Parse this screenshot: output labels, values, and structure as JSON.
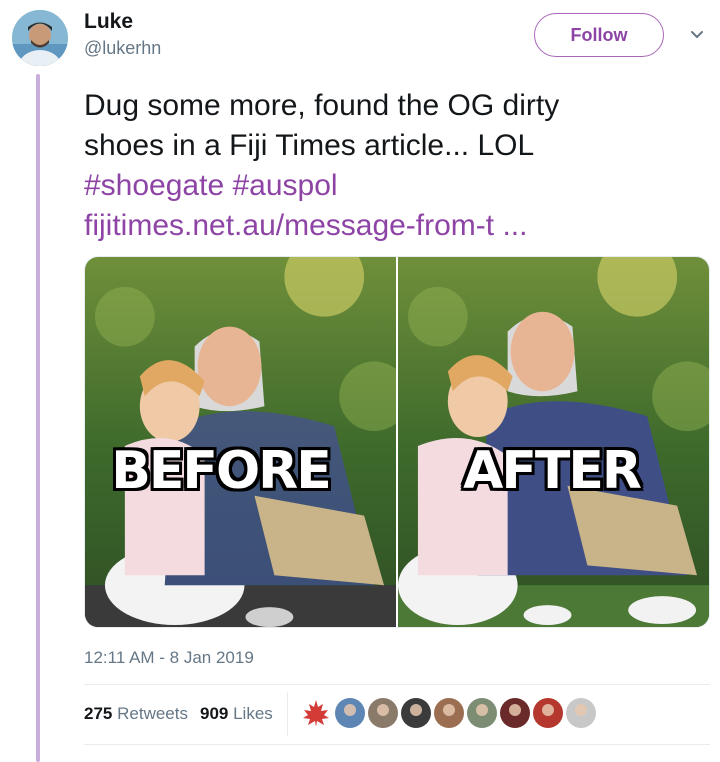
{
  "user": {
    "display_name": "Luke",
    "handle": "@lukerhn"
  },
  "follow_button": {
    "label": "Follow"
  },
  "tweet": {
    "text_line1": "Dug some more, found the OG dirty",
    "text_line2": "shoes in a Fiji Times article... LOL",
    "hashtags": [
      "#shoegate",
      "#auspol"
    ],
    "link": "fijitimes.net.au/message-from-t ...",
    "timestamp": "12:11 AM - 8 Jan 2019"
  },
  "media": {
    "before_caption": "BEFORE",
    "after_caption": "AFTER"
  },
  "stats": {
    "retweets_count": "275",
    "retweets_label": "Retweets",
    "likes_count": "909",
    "likes_label": "Likes"
  },
  "likers": [
    {
      "icon": "liker-avatar",
      "color": "#d03a2e"
    },
    {
      "icon": "liker-avatar",
      "color": "#5d86b5"
    },
    {
      "icon": "liker-avatar",
      "color": "#8a7a6a"
    },
    {
      "icon": "liker-avatar",
      "color": "#3b3b3b"
    },
    {
      "icon": "liker-avatar",
      "color": "#9b6e52"
    },
    {
      "icon": "liker-avatar",
      "color": "#7c8d74"
    },
    {
      "icon": "liker-avatar",
      "color": "#6b2a2a"
    },
    {
      "icon": "liker-avatar",
      "color": "#b5382f"
    },
    {
      "icon": "liker-avatar",
      "color": "#c8c8c8"
    }
  ],
  "colors": {
    "accent": "#8d44a5",
    "thread_line": "#c7aedb",
    "muted_text": "#657786"
  }
}
